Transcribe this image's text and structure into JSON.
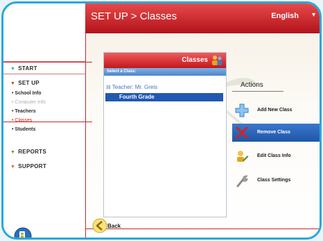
{
  "header": {
    "title": "SET UP > Classes",
    "language": "English",
    "caret": "▼"
  },
  "sidebar": {
    "start": "START",
    "setup": "SET UP",
    "setup_items": [
      "School Info",
      "Computer Info",
      "Teachers",
      "Classes",
      "Students"
    ],
    "reports": "REPORTS",
    "support": "SUPPORT"
  },
  "panel": {
    "title": "Classes",
    "subheader": "Select a Class:",
    "teacher": "Teacher: Mr. Greis",
    "teacher_marker": "⊟",
    "selected_class": "Fourth Grade"
  },
  "actions": {
    "title": "Actions",
    "items": [
      "Add New Class",
      "Remove Class",
      "Edit Class Info",
      "Class Settings"
    ]
  },
  "back_label": "Back",
  "colors": {
    "brand_red": "#c2171e",
    "frame_blue": "#2aa7dc",
    "selection_blue": "#2158b2"
  }
}
